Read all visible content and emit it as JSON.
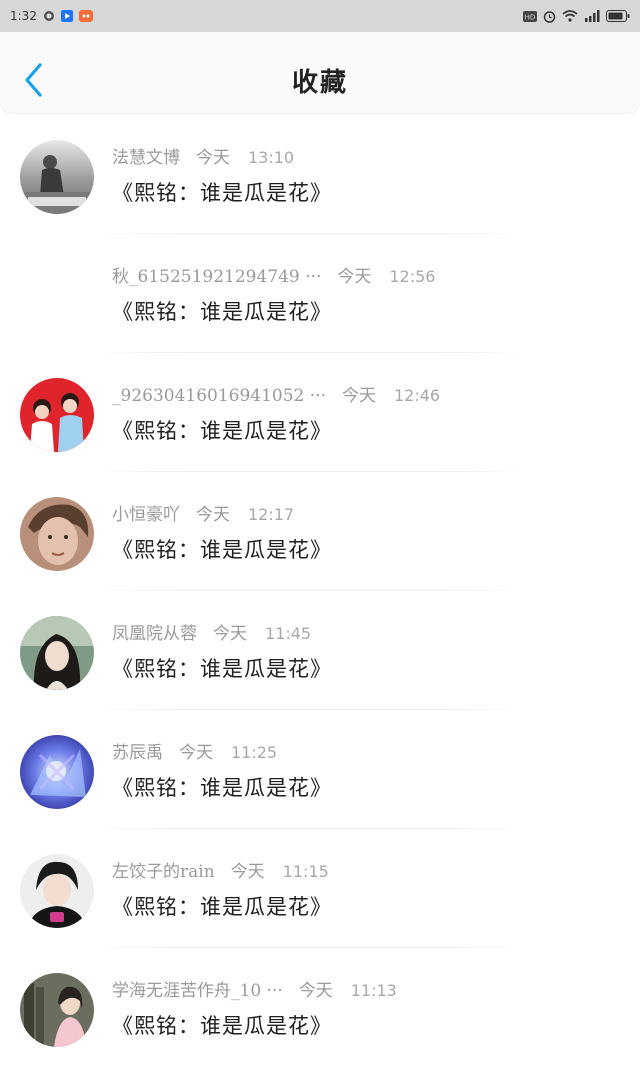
{
  "status_bar": {
    "time": "1:32",
    "left_icons": [
      "circle-app-icon",
      "blue-play-icon",
      "mascot-app-icon"
    ],
    "right_icons": [
      "hd-icon",
      "alarm-icon",
      "wifi-icon",
      "signal-icon",
      "battery-icon"
    ]
  },
  "header": {
    "title": "收藏"
  },
  "items": [
    {
      "name": "法慧文博",
      "day": "今天",
      "time": "13:10",
      "content": "《熙铭：谁是瓜是花》",
      "avatar": "photo"
    },
    {
      "name": "秋_615251921294749 ···",
      "day": "今天",
      "time": "12:56",
      "content": "《熙铭：谁是瓜是花》",
      "avatar": "none"
    },
    {
      "name": "_92630416016941052 ···",
      "day": "今天",
      "time": "12:46",
      "content": "《熙铭：谁是瓜是花》",
      "avatar": "photo"
    },
    {
      "name": "小恒豪吖",
      "day": "今天",
      "time": "12:17",
      "content": "《熙铭：谁是瓜是花》",
      "avatar": "photo"
    },
    {
      "name": "凤凰院从蓉",
      "day": "今天",
      "time": "11:45",
      "content": "《熙铭：谁是瓜是花》",
      "avatar": "photo"
    },
    {
      "name": "苏辰禹",
      "day": "今天",
      "time": "11:25",
      "content": "《熙铭：谁是瓜是花》",
      "avatar": "photo"
    },
    {
      "name": "左饺子的rain",
      "day": "今天",
      "time": "11:15",
      "content": "《熙铭：谁是瓜是花》",
      "avatar": "photo"
    },
    {
      "name": "学海无涯苦作舟_10 ···",
      "day": "今天",
      "time": "11:13",
      "content": "《熙铭：谁是瓜是花》",
      "avatar": "photo"
    }
  ],
  "colors": {
    "accent": "#1a9ff0",
    "status_bg": "#d7d7d7"
  }
}
